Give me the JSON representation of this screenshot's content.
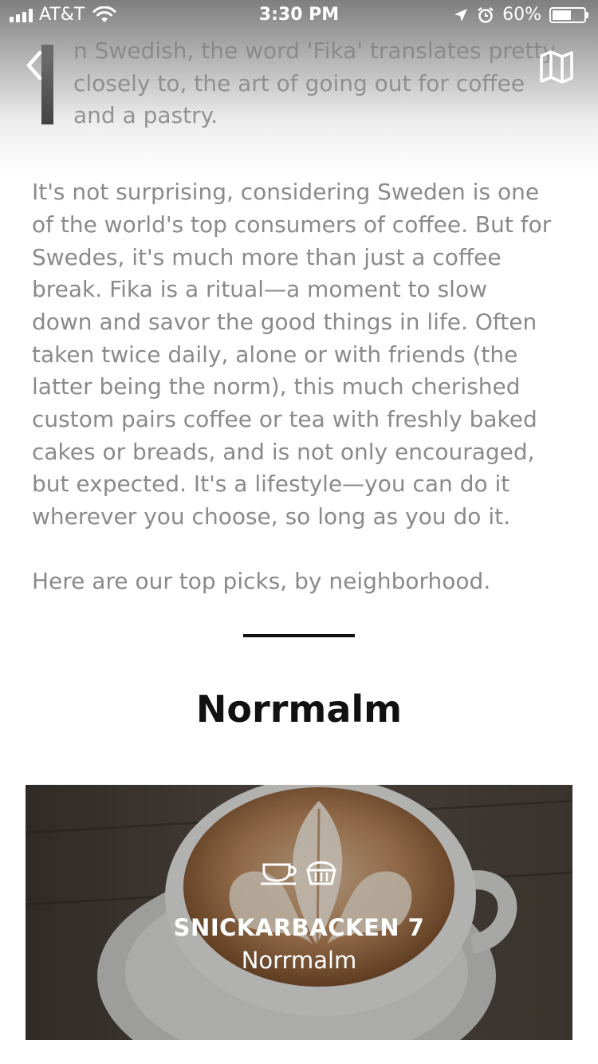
{
  "status_bar": {
    "carrier": "AT&T",
    "time": "3:30 PM",
    "battery_text": "60%",
    "battery_level": 0.6,
    "icons": [
      "signal-icon",
      "wifi-icon",
      "location-arrow-icon",
      "alarm-icon",
      "battery-icon"
    ]
  },
  "nav": {
    "back_icon": "chevron-left-icon",
    "map_icon": "folded-map-icon"
  },
  "article": {
    "pullquote_lines": [
      "n Swedish, the word 'Fika' translates pretty",
      "closely to, the art of going out for coffee",
      "and a pastry."
    ],
    "body_lines": [
      "It's not surprising, considering Sweden is one",
      "of the world's top consumers of coffee. But for",
      "Swedes, it's much more than just a coffee",
      "break. Fika is a ritual—a moment to slow",
      "down and savor the good things in life. Often",
      "taken twice daily, alone or with friends (the",
      "latter being the norm), this much cherished",
      "custom pairs coffee or tea with freshly baked",
      "cakes or breads, and is not only encouraged,",
      "but expected. It's a lifestyle—you can do it",
      "wherever you choose, so long as you do it."
    ],
    "picks_text": "Here are our top picks, by neighborhood."
  },
  "section": {
    "heading": "Norrmalm"
  },
  "venue_card": {
    "icons": [
      "coffee-cup-icon",
      "pastry-icon"
    ],
    "name": "SNICKARBACKEN 7",
    "neighborhood": "Norrmalm"
  },
  "colors": {
    "text_gray": "#8a8a8a",
    "heading": "#111111",
    "quote_bar": "#000000",
    "white": "#ffffff"
  }
}
